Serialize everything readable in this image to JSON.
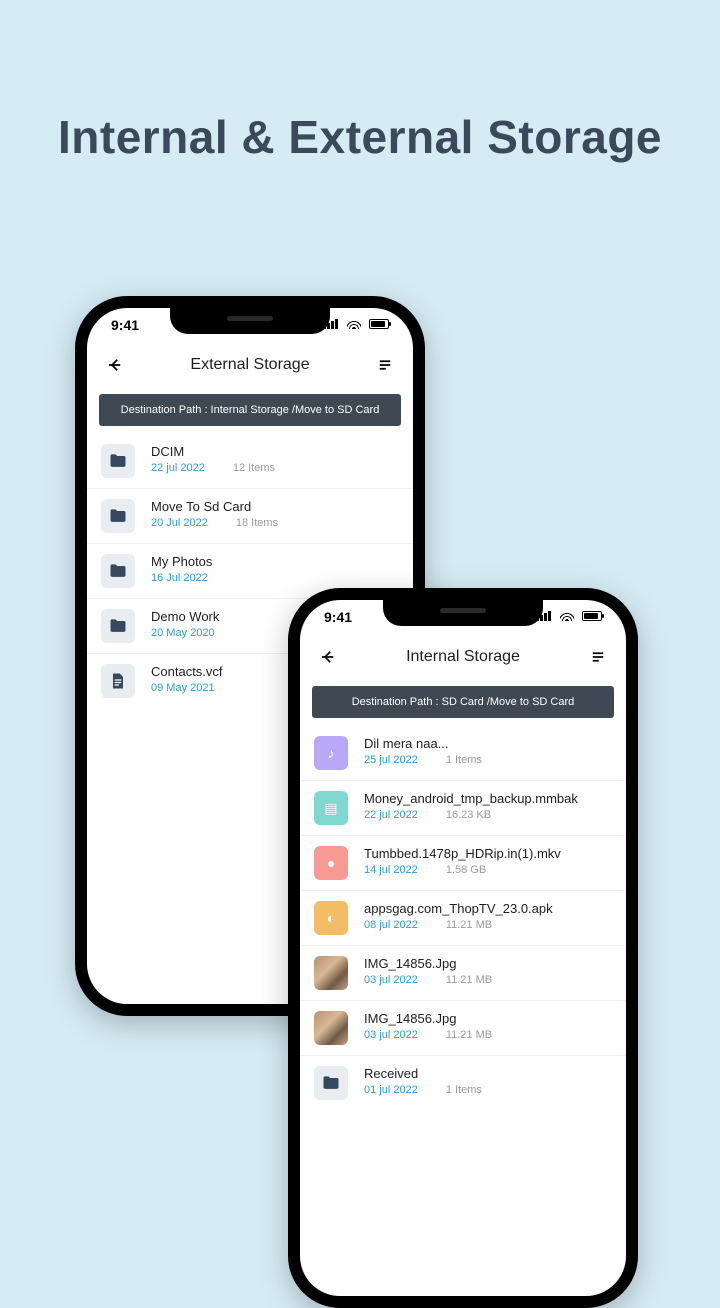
{
  "headline": "Internal & External Storage",
  "statusbar": {
    "time": "9:41"
  },
  "phone1": {
    "title": "External Storage",
    "path": "Destination Path : Internal Storage /Move to SD Card",
    "items": [
      {
        "icon": "folder",
        "name": "DCIM",
        "date": "22 jul 2022",
        "size": "12 Items"
      },
      {
        "icon": "folder",
        "name": "Move To Sd Card",
        "date": "20 Jul 2022",
        "size": "18 Items"
      },
      {
        "icon": "folder",
        "name": "My Photos",
        "date": "16 Jul 2022",
        "size": ""
      },
      {
        "icon": "folder",
        "name": "Demo Work",
        "date": "20 May 2020",
        "size": ""
      },
      {
        "icon": "doc",
        "name": "Contacts.vcf",
        "date": "09 May 2021",
        "size": ""
      }
    ]
  },
  "phone2": {
    "title": "Internal Storage",
    "path": "Destination Path : SD Card /Move to SD Card",
    "items": [
      {
        "icon": "music",
        "name": "Dil mera naa...",
        "date": "25 jul 2022",
        "size": "1 Items"
      },
      {
        "icon": "file",
        "name": "Money_android_tmp_backup.mmbak",
        "date": "22 jul 2022",
        "size": "16.23 KB"
      },
      {
        "icon": "video",
        "name": "Tumbbed.1478p_HDRip.in(1).mkv",
        "date": "14 jul 2022",
        "size": "1.58 GB"
      },
      {
        "icon": "apk",
        "name": "appsgag.com_ThopTV_23.0.apk",
        "date": "08 jul 2022",
        "size": "11.21 MB"
      },
      {
        "icon": "image",
        "name": "IMG_14856.Jpg",
        "date": "03 jul 2022",
        "size": "11.21 MB"
      },
      {
        "icon": "image",
        "name": "IMG_14856.Jpg",
        "date": "03 jul 2022",
        "size": "11.21 MB"
      },
      {
        "icon": "folder",
        "name": "Received",
        "date": "01 jul 2022",
        "size": "1 Items"
      }
    ]
  }
}
